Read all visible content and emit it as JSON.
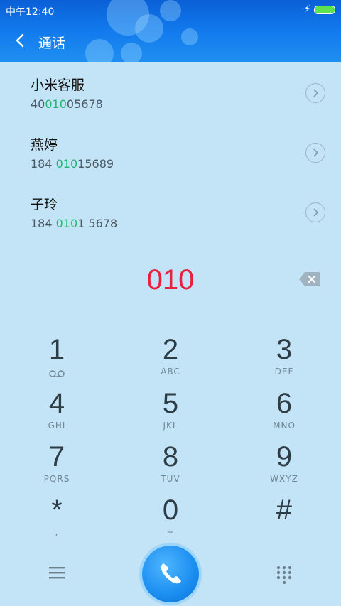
{
  "status_bar": {
    "time": "中午12:40"
  },
  "header": {
    "title": "通话"
  },
  "contacts": [
    {
      "name": "小米客服",
      "number_pre": "40",
      "number_match": "010",
      "number_post": "05678"
    },
    {
      "name": "燕婷",
      "number_pre": "184 ",
      "number_match": "010",
      "number_post": "15689"
    },
    {
      "name": "子玲",
      "number_pre": "184 ",
      "number_match": "010",
      "number_post": "1 5678"
    }
  ],
  "dialer": {
    "input": "010"
  },
  "keys": [
    {
      "digit": "1",
      "letters": ""
    },
    {
      "digit": "2",
      "letters": "ABC"
    },
    {
      "digit": "3",
      "letters": "DEF"
    },
    {
      "digit": "4",
      "letters": "GHI"
    },
    {
      "digit": "5",
      "letters": "JKL"
    },
    {
      "digit": "6",
      "letters": "MNO"
    },
    {
      "digit": "7",
      "letters": "PQRS"
    },
    {
      "digit": "8",
      "letters": "TUV"
    },
    {
      "digit": "9",
      "letters": "WXYZ"
    },
    {
      "digit": "*",
      "letters": ","
    },
    {
      "digit": "0",
      "letters": "+"
    },
    {
      "digit": "#",
      "letters": ""
    }
  ],
  "colors": {
    "accent": "#e8213f",
    "match": "#22b573",
    "call": "#1a8df0"
  }
}
